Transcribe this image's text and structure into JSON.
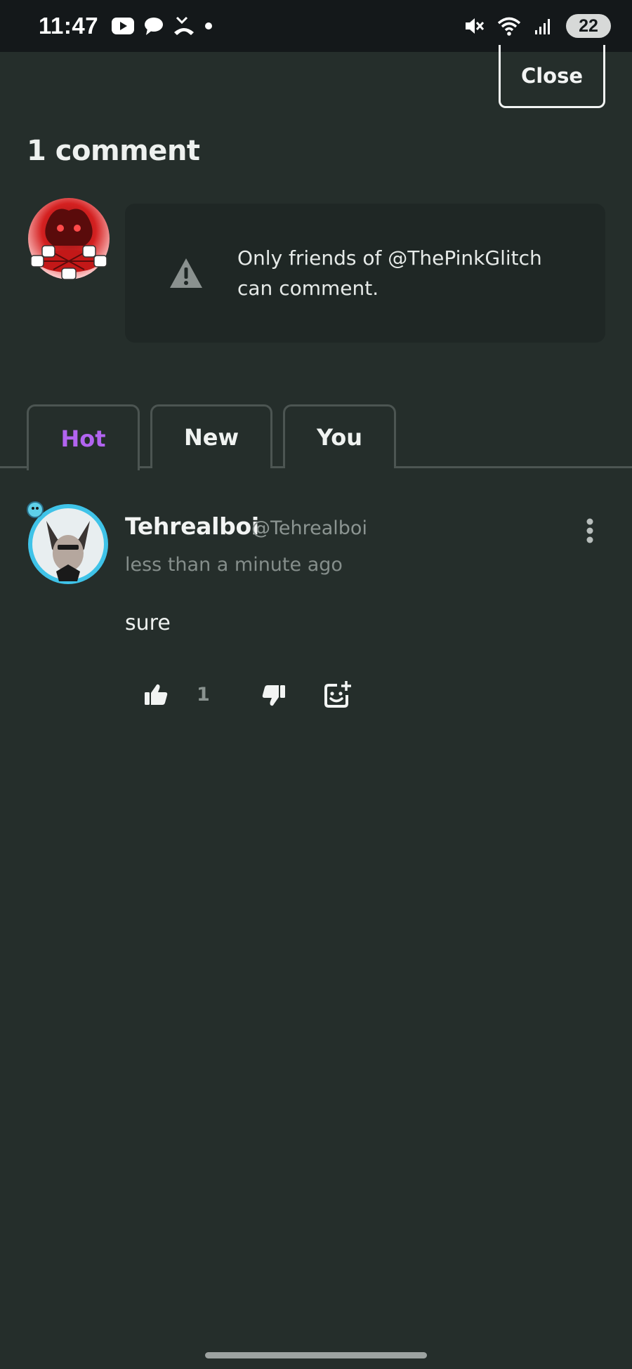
{
  "status_bar": {
    "time": "11:47",
    "battery": "22",
    "icons": [
      "youtube-icon",
      "chat-icon",
      "missed-call-icon",
      "dot-icon",
      "mute-icon",
      "wifi-icon",
      "signal-icon",
      "battery-icon"
    ]
  },
  "header": {
    "close_label": "Close",
    "comment_count": "1 comment"
  },
  "notice": {
    "icon": "warning-icon",
    "text": "Only friends of @ThePinkGlitch can comment."
  },
  "tabs": [
    {
      "label": "Hot",
      "active": true
    },
    {
      "label": "New",
      "active": false
    },
    {
      "label": "You",
      "active": false
    }
  ],
  "comments": [
    {
      "name": "Tehrealboi",
      "handle": "@Tehrealboi",
      "time": "less than a minute ago",
      "body": "sure",
      "likes": "1"
    }
  ],
  "colors": {
    "background": "#252e2b",
    "notice_bg": "#1f2725",
    "active_tab": "#b264f0",
    "status_bar": "#14181a"
  }
}
